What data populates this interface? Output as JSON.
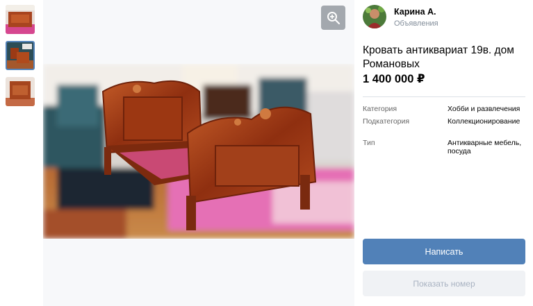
{
  "gallery": {
    "thumbnails": [
      {
        "icon": "photo-thumbnail-1",
        "selected": false
      },
      {
        "icon": "photo-thumbnail-2",
        "selected": true
      },
      {
        "icon": "photo-thumbnail-3",
        "selected": false
      }
    ],
    "zoom_icon": "zoom-in-icon",
    "photo_icon": "antique-bed-photo"
  },
  "seller": {
    "name": "Карина А.",
    "subtitle": "Объявления",
    "avatar_icon": "avatar-icon"
  },
  "listing": {
    "title": "Кровать антиквариат 19в. дом Романовых",
    "price": "1 400 000 ₽",
    "properties": [
      {
        "label": "Категория",
        "value": "Хобби и развлечения"
      },
      {
        "label": "Подкатегория",
        "value": "Коллекционирование"
      },
      {
        "label": "Тип",
        "value": "Антикварные мебель, посуда"
      }
    ]
  },
  "actions": {
    "write_label": "Написать",
    "phone_label": "Показать номер"
  },
  "colors": {
    "accent": "#5181b8",
    "secondary_button_bg": "#f0f2f5",
    "secondary_button_text": "#a8b2c1",
    "muted_text": "#818c99"
  }
}
